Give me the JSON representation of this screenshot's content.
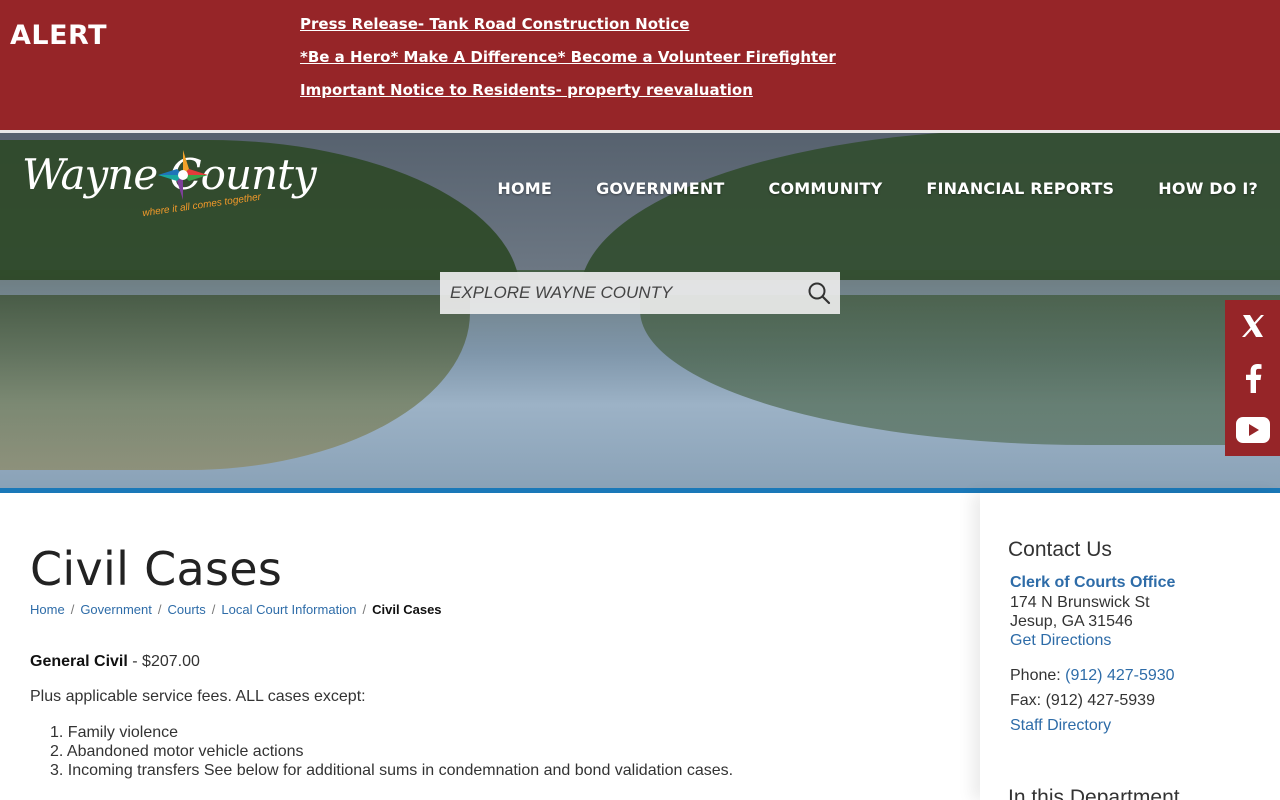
{
  "alert": {
    "label": "ALERT",
    "links": [
      "Press Release- Tank Road Construction Notice",
      "*Be a Hero* Make A Difference* Become a Volunteer Firefighter",
      "Important Notice to Residents- property reevaluation"
    ]
  },
  "header": {
    "logo_text": "Wayne County",
    "logo_tagline": "where it all comes together",
    "nav": [
      "HOME",
      "GOVERNMENT",
      "COMMUNITY",
      "FINANCIAL REPORTS",
      "HOW DO I?"
    ],
    "search_placeholder": "EXPLORE WAYNE COUNTY"
  },
  "social": [
    "x-icon",
    "facebook-icon",
    "youtube-icon"
  ],
  "main": {
    "title": "Civil Cases",
    "breadcrumb": [
      "Home",
      "Government",
      "Courts",
      "Local Court Information"
    ],
    "breadcrumb_current": "Civil Cases",
    "general_civil_label": "General Civil",
    "general_civil_value": "- $207.00",
    "intro": "Plus applicable service fees. ALL cases except:",
    "list": [
      "1. Family violence",
      "2. Abandoned motor vehicle actions",
      "3. Incoming transfers See below for additional sums in condemnation and bond validation cases."
    ]
  },
  "sidebar": {
    "title": "Contact Us",
    "office": "Clerk of Courts Office",
    "address1": "174 N Brunswick St",
    "address2": "Jesup, GA 31546",
    "directions": "Get Directions",
    "phone_label": "Phone: ",
    "phone": "(912) 427-5930",
    "fax": "Fax: (912) 427-5939",
    "staff": "Staff Directory",
    "section_title": "In this Department"
  },
  "colors": {
    "alert_bg": "#962528",
    "accent_blue": "#1a78b8",
    "link": "#2e6ca8"
  }
}
